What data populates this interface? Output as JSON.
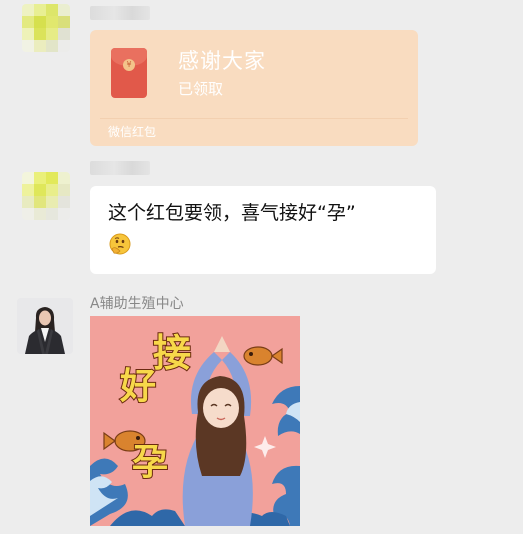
{
  "messages": {
    "red_packet": {
      "title": "感谢大家",
      "status": "已领取",
      "footer": "微信红包"
    },
    "text_message": {
      "text": "这个红包要领，喜气接好“孕”",
      "emoji": "thinking-face-icon"
    },
    "sticker_message": {
      "sender_name": "A辅助生殖中心",
      "sticker_text": [
        "接",
        "好",
        "孕"
      ]
    }
  },
  "colors": {
    "chat_background": "#ededed",
    "red_packet_bg": "#f9dcc0",
    "red_packet_icon": "#e1594a",
    "sticker_bg": "#f2a19b"
  }
}
